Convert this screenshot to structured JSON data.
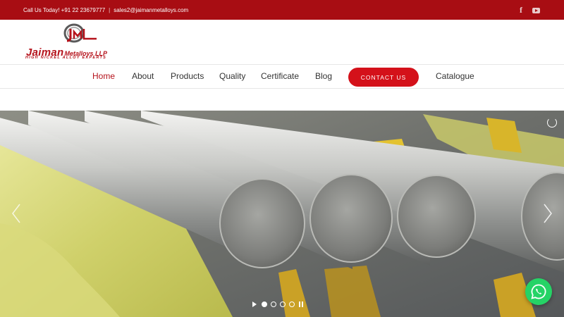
{
  "topbar": {
    "phone": "Call Us Today! +91 22 23679777",
    "separator": "|",
    "email": "sales2@jaimanmetalloys.com",
    "social": [
      "facebook-icon",
      "youtube-icon"
    ],
    "facebook_glyph": "f"
  },
  "logo": {
    "brand_main": "Jaiman",
    "brand_rest": "Metalloys LLP",
    "tagline": "HIGH NICKEL ALLOY EXPERTS",
    "mark_text": "JmL"
  },
  "nav": {
    "items": [
      {
        "label": "Home",
        "active": true
      },
      {
        "label": "About"
      },
      {
        "label": "Products"
      },
      {
        "label": "Quality"
      },
      {
        "label": "Certificate"
      },
      {
        "label": "Blog"
      }
    ],
    "cta": "CONTACT US",
    "catalogue": "Catalogue"
  },
  "hero": {
    "slides": 4,
    "current_slide": 1
  },
  "colors": {
    "brand_red": "#a80d13",
    "cta_red": "#d4111a",
    "whatsapp_green": "#25d366"
  }
}
